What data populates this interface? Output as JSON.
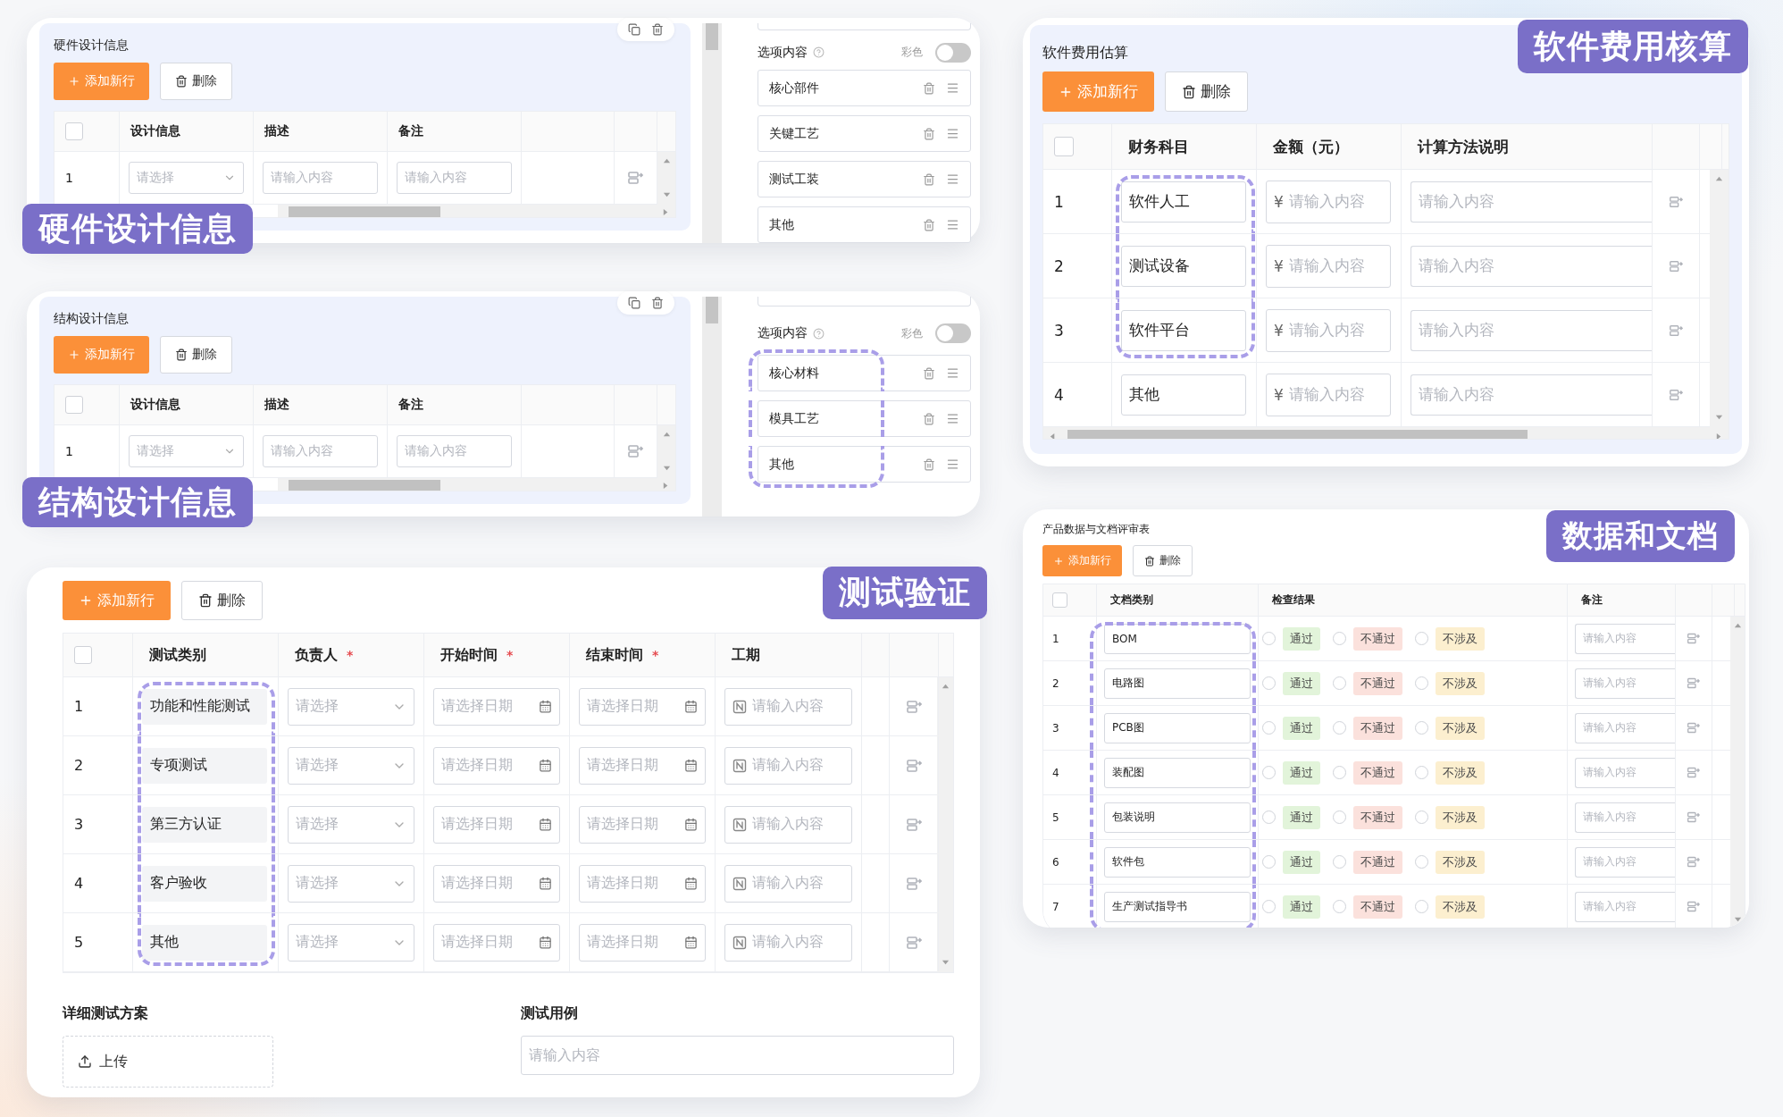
{
  "hardware": {
    "title": "硬件设计信息",
    "banner": "硬件设计信息",
    "add_button": "添加新行",
    "delete_button": "删除",
    "all_checked": false,
    "columns": [
      {
        "label": "设计信息"
      },
      {
        "label": "描述"
      },
      {
        "label": "备注"
      }
    ],
    "rows": [
      {
        "index": "1",
        "design_placeholder": "请选择",
        "description_placeholder": "请输入内容",
        "note_placeholder": "请输入内容"
      }
    ],
    "options": {
      "title": "选项内容",
      "color_label": "彩色",
      "color_on": false,
      "items": [
        {
          "label": "核心部件",
          "highlighted": false
        },
        {
          "label": "关键工艺",
          "highlighted": false
        },
        {
          "label": "测试工装",
          "highlighted": false
        },
        {
          "label": "其他",
          "highlighted": false
        }
      ]
    }
  },
  "structure": {
    "title": "结构设计信息",
    "banner": "结构设计信息",
    "add_button": "添加新行",
    "delete_button": "删除",
    "all_checked": false,
    "columns": [
      {
        "label": "设计信息"
      },
      {
        "label": "描述"
      },
      {
        "label": "备注"
      }
    ],
    "rows": [
      {
        "index": "1",
        "design_placeholder": "请选择",
        "description_placeholder": "请输入内容",
        "note_placeholder": "请输入内容"
      }
    ],
    "options": {
      "title": "选项内容",
      "color_label": "彩色",
      "color_on": false,
      "items": [
        {
          "label": "核心材料",
          "highlighted": true
        },
        {
          "label": "模具工艺",
          "highlighted": true
        },
        {
          "label": "其他",
          "highlighted": true
        }
      ]
    }
  },
  "testing": {
    "banner": "测试验证",
    "add_button": "添加新行",
    "delete_button": "删除",
    "all_checked": false,
    "columns": [
      {
        "label": "测试类别"
      },
      {
        "label": "负责人",
        "required_mark": "*"
      },
      {
        "label": "开始时间",
        "required_mark": "*"
      },
      {
        "label": "结束时间",
        "required_mark": "*"
      },
      {
        "label": "工期"
      }
    ],
    "rows": [
      {
        "index": "1",
        "category": "功能和性能测试",
        "highlighted": true,
        "owner_placeholder": "请选择",
        "start_placeholder": "请选择日期",
        "end_placeholder": "请选择日期",
        "duration_placeholder": "请输入内容"
      },
      {
        "index": "2",
        "category": "专项测试",
        "highlighted": true,
        "owner_placeholder": "请选择",
        "start_placeholder": "请选择日期",
        "end_placeholder": "请选择日期",
        "duration_placeholder": "请输入内容"
      },
      {
        "index": "3",
        "category": "第三方认证",
        "highlighted": true,
        "owner_placeholder": "请选择",
        "start_placeholder": "请选择日期",
        "end_placeholder": "请选择日期",
        "duration_placeholder": "请输入内容"
      },
      {
        "index": "4",
        "category": "客户验收",
        "highlighted": true,
        "owner_placeholder": "请选择",
        "start_placeholder": "请选择日期",
        "end_placeholder": "请选择日期",
        "duration_placeholder": "请输入内容"
      },
      {
        "index": "5",
        "category": "其他",
        "highlighted": true,
        "owner_placeholder": "请选择",
        "start_placeholder": "请选择日期",
        "end_placeholder": "请选择日期",
        "duration_placeholder": "请输入内容"
      }
    ],
    "plan": {
      "label": "详细测试方案",
      "upload_button": "上传"
    },
    "cases": {
      "label": "测试用例",
      "placeholder": "请输入内容"
    }
  },
  "software": {
    "title": "软件费用估算",
    "banner": "软件费用核算",
    "add_button": "添加新行",
    "delete_button": "删除",
    "all_checked": false,
    "columns": [
      {
        "label": "财务科目"
      },
      {
        "label": "金额（元）"
      },
      {
        "label": "计算方法说明"
      }
    ],
    "rows": [
      {
        "index": "1",
        "item": "软件人工",
        "highlighted": true,
        "currency": "¥",
        "amount_placeholder": "请输入内容",
        "method_placeholder": "请输入内容"
      },
      {
        "index": "2",
        "item": "测试设备",
        "highlighted": true,
        "currency": "¥",
        "amount_placeholder": "请输入内容",
        "method_placeholder": "请输入内容"
      },
      {
        "index": "3",
        "item": "软件平台",
        "highlighted": true,
        "currency": "¥",
        "amount_placeholder": "请输入内容",
        "method_placeholder": "请输入内容"
      },
      {
        "index": "4",
        "item": "其他",
        "highlighted": false,
        "currency": "¥",
        "amount_placeholder": "请输入内容",
        "method_placeholder": "请输入内容"
      }
    ]
  },
  "documents": {
    "title": "产品数据与文档评审表",
    "banner": "数据和文档",
    "add_button": "添加新行",
    "delete_button": "删除",
    "all_checked": false,
    "columns": [
      {
        "label": "文档类别"
      },
      {
        "label": "检查结果"
      },
      {
        "label": "备注"
      }
    ],
    "rows": [
      {
        "index": "1",
        "category": "BOM",
        "highlighted": true,
        "results": [
          {
            "label": "通过",
            "selected": false,
            "color": "#e2f4da"
          },
          {
            "label": "不通过",
            "selected": false,
            "color": "#fbe1dc"
          },
          {
            "label": "不涉及",
            "selected": false,
            "color": "#fcefcf"
          }
        ],
        "note_placeholder": "请输入内容"
      },
      {
        "index": "2",
        "category": "电路图",
        "highlighted": true,
        "results": [
          {
            "label": "通过",
            "selected": false,
            "color": "#e2f4da"
          },
          {
            "label": "不通过",
            "selected": false,
            "color": "#fbe1dc"
          },
          {
            "label": "不涉及",
            "selected": false,
            "color": "#fcefcf"
          }
        ],
        "note_placeholder": "请输入内容"
      },
      {
        "index": "3",
        "category": "PCB图",
        "highlighted": true,
        "results": [
          {
            "label": "通过",
            "selected": false,
            "color": "#e2f4da"
          },
          {
            "label": "不通过",
            "selected": false,
            "color": "#fbe1dc"
          },
          {
            "label": "不涉及",
            "selected": false,
            "color": "#fcefcf"
          }
        ],
        "note_placeholder": "请输入内容"
      },
      {
        "index": "4",
        "category": "装配图",
        "highlighted": true,
        "results": [
          {
            "label": "通过",
            "selected": false,
            "color": "#e2f4da"
          },
          {
            "label": "不通过",
            "selected": false,
            "color": "#fbe1dc"
          },
          {
            "label": "不涉及",
            "selected": false,
            "color": "#fcefcf"
          }
        ],
        "note_placeholder": "请输入内容"
      },
      {
        "index": "5",
        "category": "包装说明",
        "highlighted": true,
        "results": [
          {
            "label": "通过",
            "selected": false,
            "color": "#e2f4da"
          },
          {
            "label": "不通过",
            "selected": false,
            "color": "#fbe1dc"
          },
          {
            "label": "不涉及",
            "selected": false,
            "color": "#fcefcf"
          }
        ],
        "note_placeholder": "请输入内容"
      },
      {
        "index": "6",
        "category": "软件包",
        "highlighted": true,
        "results": [
          {
            "label": "通过",
            "selected": false,
            "color": "#e2f4da"
          },
          {
            "label": "不通过",
            "selected": false,
            "color": "#fbe1dc"
          },
          {
            "label": "不涉及",
            "selected": false,
            "color": "#fcefcf"
          }
        ],
        "note_placeholder": "请输入内容"
      },
      {
        "index": "7",
        "category": "生产测试指导书",
        "highlighted": true,
        "results": [
          {
            "label": "通过",
            "selected": false,
            "color": "#e2f4da"
          },
          {
            "label": "不通过",
            "selected": false,
            "color": "#fbe1dc"
          },
          {
            "label": "不涉及",
            "selected": false,
            "color": "#fcefcf"
          }
        ],
        "note_placeholder": "请输入内容"
      }
    ]
  }
}
